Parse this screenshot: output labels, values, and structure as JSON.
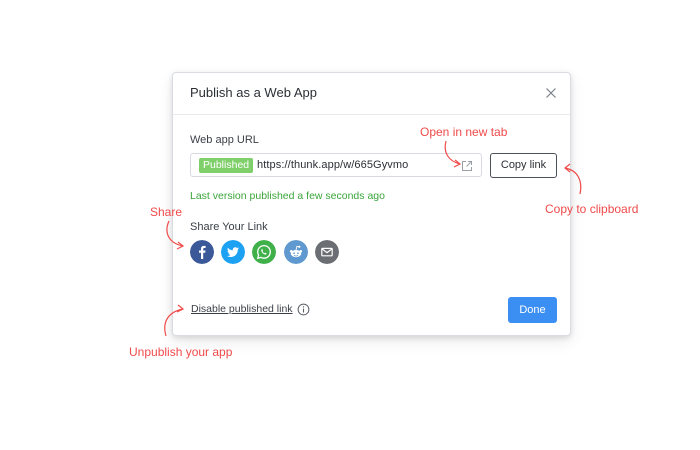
{
  "dialog": {
    "title": "Publish as a Web App",
    "url_label": "Web app URL",
    "badge": "Published",
    "url": "https://thunk.app/w/665Gyvmo",
    "copy_label": "Copy link",
    "status": "Last version published a few seconds ago",
    "share_label": "Share Your Link",
    "disable_label": "Disable published link",
    "done_label": "Done"
  },
  "share_icons": [
    {
      "name": "facebook-icon",
      "color": "#3b5998"
    },
    {
      "name": "twitter-icon",
      "color": "#1da1f2"
    },
    {
      "name": "whatsapp-icon",
      "color": "#40b14a"
    },
    {
      "name": "reddit-icon",
      "color": "#5f99cf"
    },
    {
      "name": "email-icon",
      "color": "#6b6e73"
    }
  ],
  "annotations": {
    "open_tab": "Open in new tab",
    "copy": "Copy to clipboard",
    "share": "Share",
    "unpublish": "Unpublish your app"
  },
  "colors": {
    "accent": "#3b8ff2",
    "badge": "#7fcf6a",
    "status": "#3aa53a",
    "annotation": "#f04a4a"
  }
}
